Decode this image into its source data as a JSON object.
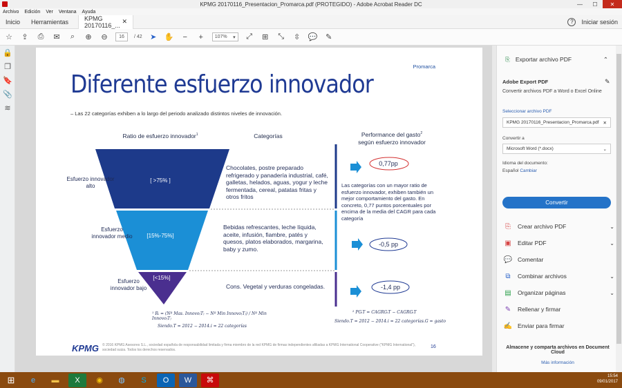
{
  "window": {
    "title": "KPMG 20170116_Presentacion_Promarca.pdf (PROTEGIDO) - Adobe Acrobat Reader DC"
  },
  "menu": [
    "Archivo",
    "Edición",
    "Ver",
    "Ventana",
    "Ayuda"
  ],
  "tabs": {
    "home": "Inicio",
    "tools": "Herramientas",
    "doc": "KPMG 20170116_...",
    "signin": "Iniciar sesión"
  },
  "toolbar": {
    "page_current": "16",
    "page_total": "/ 42",
    "zoom": "107%"
  },
  "slide": {
    "brand": "Promarca",
    "title": "Diferente esfuerzo innovador",
    "subtitle": "–  Las 22 categorías exhiben a lo largo del periodo analizado distintos niveles de innovación.",
    "col_ratio": "Ratio de esfuerzo innovador",
    "col_ratio_sup": "1",
    "col_categories": "Categorías",
    "col_perf_line1": "Performance del gasto",
    "col_perf_sup": "2",
    "col_perf_line2": "según esfuerzo innovador",
    "levels": [
      {
        "label": "Esfuerzo innovador alto",
        "range": "[ >75% ]",
        "categories": "Chocolates, postre preparado refrigerado y panadería industrial, café, galletas, helados, aguas, yogur y leche fermentada, cereal, patatas fritas y otros fritos",
        "perf": "0,77pp"
      },
      {
        "label": "Esfuerzo innovador medio",
        "range": "[15%-75%]",
        "categories": "Bebidas refrescantes, leche líquida, aceite, infusión, fiambre, patés y quesos, platos elaborados, margarina, baby y zumo.",
        "perf": "-0,5 pp"
      },
      {
        "label": "Esfuerzo innovador bajo",
        "range": "[<15%]",
        "categories": "Cons. Vegetal y verduras congeladas.",
        "perf": "-1,4 pp"
      }
    ],
    "perf_note": "Las categorías con un mayor ratio de esfuerzo innovador, exhiben también un mejor comportamiento del gasto. En concreto, 0,77 puntos porcentuales por encima de la media del CAGR para cada categoría",
    "formula1": "¹ Rᵢ = (Nº Mas. Innovo₍T₎ − Nº Min Innovo₍T₎) / Nº Min Innovo₍T₎",
    "formula1_note": "Siendo.T = 2012 − 2014.i = 22 categorías",
    "formula2": "² PGᵢT = CAGRGᵢT − CAGRGᵢT",
    "formula2_note": "Siendo.T = 2012 − 2014.i = 22 categorías.G = gasto",
    "logo": "KPMG",
    "footer": "© 2016 KPMG Asesores S.L., sociedad española de responsabilidad limitada y firma miembro de la red KPMG de firmas independientes afiliadas a KPMG International Cooperative (\"KPMG International\"), sociedad suiza. Todos los derechos reservados.",
    "page_number": "16"
  },
  "right_panel": {
    "export_header": "Exportar archivo PDF",
    "export_title": "Adobe Export PDF",
    "export_desc": "Convertir archivos PDF a Word o Excel Online",
    "select_label": "Seleccionar archivo PDF",
    "selected_file": "KPMG 20170116_Presentacion_Promarca.pdf",
    "convert_label": "Convertir a",
    "convert_value": "Microsoft Word (*.docx)",
    "lang_label": "Idioma del documento:",
    "lang_value": "Español",
    "lang_change": "Cambiar",
    "convert_button": "Convertir",
    "tools": [
      "Crear archivo PDF",
      "Editar PDF",
      "Comentar",
      "Combinar archivos",
      "Organizar páginas",
      "Rellenar y firmar",
      "Enviar para firmar"
    ],
    "footer": "Almacene y comparta archivos en Document Cloud",
    "more_info": "Más información"
  },
  "taskbar": {
    "time": "15:54",
    "date": "09/01/2017"
  },
  "colors": {
    "accent": "#2473c8",
    "dark_blue": "#1f3a93",
    "funnel_top": "#1d3a8a",
    "funnel_mid": "#1b8fd6",
    "funnel_bottom": "#4a2f8f"
  }
}
